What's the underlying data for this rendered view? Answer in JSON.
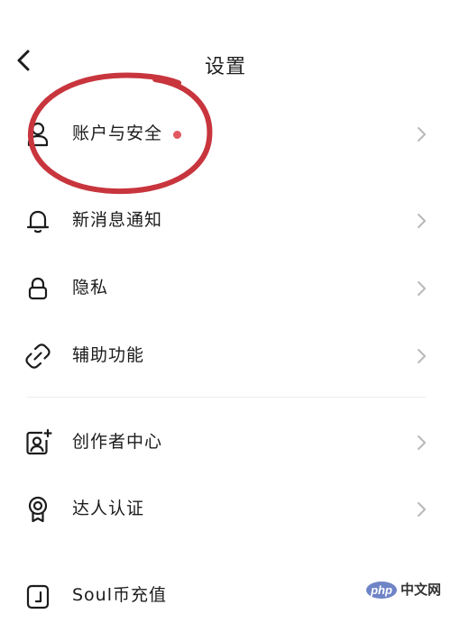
{
  "header": {
    "title": "设置",
    "back_icon": "chevron-left-icon"
  },
  "settings_items": [
    {
      "label": "账户与安全",
      "icon": "user-icon",
      "badge": "red-dot"
    },
    {
      "label": "新消息通知",
      "icon": "bell-icon"
    },
    {
      "label": "隐私",
      "icon": "lock-icon"
    },
    {
      "label": "辅助功能",
      "icon": "link-icon"
    },
    {
      "label": "创作者中心",
      "icon": "creator-icon"
    },
    {
      "label": "达人认证",
      "icon": "badge-icon"
    },
    {
      "label": "Soul币充值",
      "icon": "wallet-icon"
    }
  ],
  "colors": {
    "annotation": "#c8353d",
    "badge_dot": "#e05a60",
    "chevron": "#b8b8b8",
    "text": "#1c1c1c",
    "watermark_blue": "#6f84c7"
  },
  "watermark": {
    "logo": "php",
    "text": "中文网"
  }
}
